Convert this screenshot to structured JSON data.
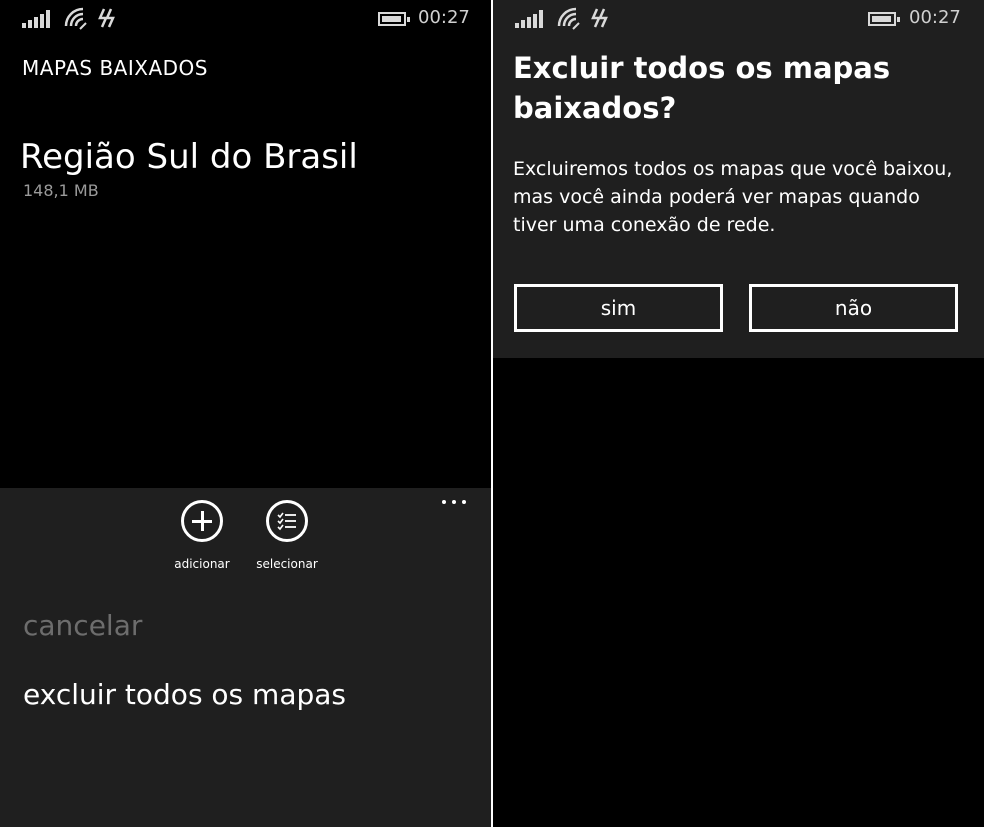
{
  "status_bar": {
    "time": "00:27"
  },
  "list_screen": {
    "title": "MAPAS BAIXADOS",
    "map_item": {
      "name": "Região Sul do Brasil",
      "size": "148,1 MB"
    },
    "app_bar": {
      "buttons": [
        {
          "label": "adicionar",
          "icon": "add-circle-icon"
        },
        {
          "label": "selecionar",
          "icon": "select-list-icon"
        }
      ],
      "menu_items": [
        {
          "label": "cancelar",
          "enabled": false
        },
        {
          "label": "excluir todos os mapas",
          "enabled": true
        }
      ]
    }
  },
  "dialog_screen": {
    "title": "Excluir todos os mapas baixados?",
    "message": "Excluiremos todos os mapas que você baixou, mas você ainda poderá ver mapas quando tiver uma conexão de rede.",
    "buttons": {
      "yes": "sim",
      "no": "não"
    }
  },
  "colors": {
    "background": "#000000",
    "panel": "#1f1f1f",
    "text": "#ffffff",
    "dim_text": "#6d6d6d"
  }
}
